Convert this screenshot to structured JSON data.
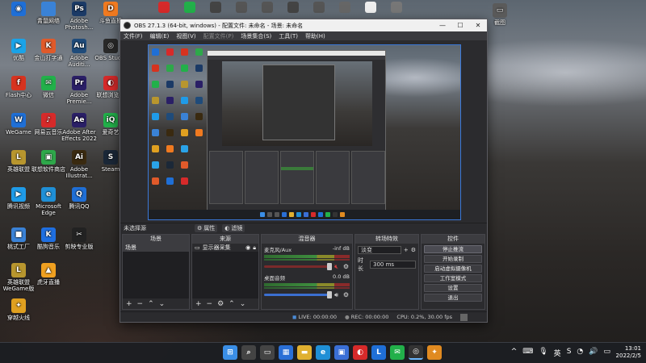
{
  "desktop": {
    "icons": [
      {
        "label": "",
        "color": "#1f6fd6",
        "glyph": "◉"
      },
      {
        "label": "优酷",
        "color": "#1aa3e8",
        "glyph": "▶"
      },
      {
        "label": "Flash中心",
        "color": "#d6331f",
        "glyph": "f"
      },
      {
        "label": "WeGame",
        "color": "#1f6fd6",
        "glyph": "W"
      },
      {
        "label": "英雄联盟",
        "color": "#b8962e",
        "glyph": "L"
      },
      {
        "label": "腾讯视频",
        "color": "#1f9be8",
        "glyph": "▶"
      },
      {
        "label": "桃式工厂",
        "color": "#3a82d6",
        "glyph": "■"
      },
      {
        "label": "英雄联盟WeGame版",
        "color": "#b8962e",
        "glyph": "L"
      },
      {
        "label": "穿越火线",
        "color": "#e0a020",
        "glyph": "✦"
      },
      {
        "label": "金山助手",
        "color": "#2aa3e8",
        "glyph": "◆"
      },
      {
        "label": "金山打字通",
        "color": "#e05a2a",
        "glyph": "K"
      },
      {
        "label": "微信",
        "color": "#22b04a",
        "glyph": "✉"
      },
      {
        "label": "网易云音乐",
        "color": "#d62a2a",
        "glyph": "♪"
      },
      {
        "label": "联想软件商店",
        "color": "#2ea84a",
        "glyph": "▣"
      },
      {
        "label": "Microsoft Edge",
        "color": "#1f8fd6",
        "glyph": "e"
      },
      {
        "label": "酷狗音乐",
        "color": "#1f6fe0",
        "glyph": "K"
      },
      {
        "label": "虎牙直播",
        "color": "#f0a020",
        "glyph": "▲"
      },
      {
        "label": "Adobe Photosh...",
        "color": "#1b3a66",
        "glyph": "Ps"
      },
      {
        "label": "Adobe Auditi...",
        "color": "#1f4b7a",
        "glyph": "Au"
      },
      {
        "label": "Adobe Premie...",
        "color": "#2a1f66",
        "glyph": "Pr"
      },
      {
        "label": "Adobe After Effects 2022",
        "color": "#2a1f66",
        "glyph": "Ae"
      },
      {
        "label": "Adobe Illustrat...",
        "color": "#3a2a10",
        "glyph": "Ai"
      },
      {
        "label": "腾讯QQ",
        "color": "#1f6fd6",
        "glyph": "Q"
      },
      {
        "label": "剪映专业版",
        "color": "#222222",
        "glyph": "✂"
      },
      {
        "label": "斗鱼直播",
        "color": "#f07a20",
        "glyph": "D"
      },
      {
        "label": "OBS Studio",
        "color": "#2a2a2a",
        "glyph": "◎"
      },
      {
        "label": "联想浏览器",
        "color": "#d62a2a",
        "glyph": "◐"
      },
      {
        "label": "爱奇艺",
        "color": "#22b04a",
        "glyph": "iQ"
      },
      {
        "label": "Steam",
        "color": "#1b2838",
        "glyph": "S"
      }
    ],
    "top_row_icons": [
      {
        "label": "青鼠网络",
        "color": "#3a82d6"
      },
      {
        "label": "",
        "color": "#d62a2a"
      },
      {
        "label": "",
        "color": "#22b04a"
      },
      {
        "label": "",
        "color": "#444444"
      },
      {
        "label": "",
        "color": "#555555"
      },
      {
        "label": "",
        "color": "#555555"
      },
      {
        "label": "",
        "color": "#444444"
      },
      {
        "label": "",
        "color": "#555555"
      },
      {
        "label": "",
        "color": "#666666"
      },
      {
        "label": "",
        "color": "#eeeeee"
      },
      {
        "label": "",
        "color": "#777777"
      }
    ],
    "top_right_label": "截图"
  },
  "obs": {
    "title": "OBS 27.1.3 (64-bit, windows) - 配置文件: 未命名 - 场景: 未命名",
    "window_buttons": [
      "—",
      "☐",
      "✕"
    ],
    "menu": [
      "文件(F)",
      "编辑(E)",
      "视图(V)",
      "配置文件(P)",
      "场景集合(S)",
      "工具(T)",
      "帮助(H)"
    ],
    "menu_disabled_index": 3,
    "scene_toolbar": {
      "label": "未选择源",
      "properties": "属性",
      "filters": "滤镜"
    },
    "scenes": {
      "title": "场景",
      "items": [
        "场景"
      ]
    },
    "sources": {
      "title": "来源",
      "items": [
        {
          "label": "显示器采集"
        }
      ]
    },
    "mixer": {
      "title": "混音器",
      "tracks": [
        {
          "name": "麦克风/Aux",
          "level": "-inf dB",
          "muted": true
        },
        {
          "name": "桌面音频",
          "level": "0.0 dB",
          "muted": false
        }
      ]
    },
    "transitions": {
      "title": "转场特效",
      "type": "淡变",
      "duration_label": "时长",
      "duration": "300 ms"
    },
    "controls": {
      "title": "控件",
      "buttons": [
        "停止推流",
        "开始录制",
        "启动虚拟摄像机",
        "工作室模式",
        "设置",
        "退出"
      ],
      "active_index": 0
    },
    "status": {
      "live": "LIVE: 00:00:00",
      "rec": "REC: 00:00:00",
      "cpu": "CPU: 0.2%, 30.00 fps"
    }
  },
  "taskbar": {
    "apps": [
      {
        "name": "windows-start",
        "color": "#3a8ee6",
        "glyph": "⊞"
      },
      {
        "name": "search",
        "color": "#444444",
        "glyph": "⌕"
      },
      {
        "name": "task-view",
        "color": "#444444",
        "glyph": "▭"
      },
      {
        "name": "widgets",
        "color": "#2a6fd6",
        "glyph": "▦"
      },
      {
        "name": "file-explorer",
        "color": "#e0b030",
        "glyph": "▬"
      },
      {
        "name": "edge",
        "color": "#1f8fd6",
        "glyph": "e"
      },
      {
        "name": "store",
        "color": "#3a6fd6",
        "glyph": "▣"
      },
      {
        "name": "lenovo",
        "color": "#d62a2a",
        "glyph": "◐"
      },
      {
        "name": "lenovo-l",
        "color": "#1f6fd6",
        "glyph": "L"
      },
      {
        "name": "wechat",
        "color": "#22b04a",
        "glyph": "✉"
      },
      {
        "name": "obs",
        "color": "#333333",
        "glyph": "◎"
      },
      {
        "name": "app",
        "color": "#e08a20",
        "glyph": "✦"
      }
    ],
    "active_app_index": 10,
    "tray_icons": [
      "^",
      "⌨",
      "🎙",
      "英",
      "S",
      "◔",
      "🔊",
      "▭"
    ],
    "time": "13:01",
    "date": "2022/2/5"
  }
}
